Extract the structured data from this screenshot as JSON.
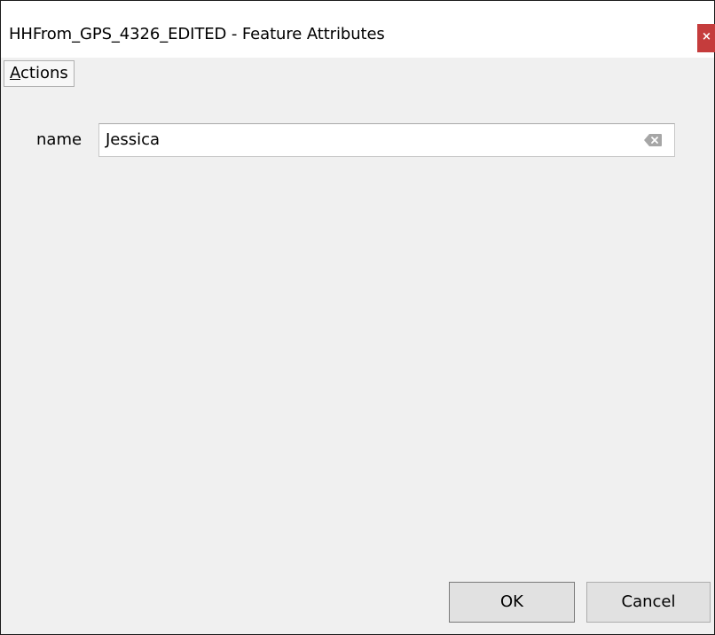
{
  "window": {
    "title": "HHFrom_GPS_4326_EDITED - Feature Attributes",
    "close_icon": "close-icon",
    "close_glyph": "×"
  },
  "menu": {
    "items": [
      {
        "label_prefix": "A",
        "label_rest": "ctions"
      }
    ]
  },
  "form": {
    "fields": [
      {
        "label": "name",
        "value": "Jessica",
        "clear_icon": "clear-icon"
      }
    ]
  },
  "buttons": {
    "ok_label": "OK",
    "cancel_label": "Cancel"
  },
  "colors": {
    "close_bg": "#c53c3c",
    "window_bg": "#f0f0f0",
    "button_bg": "#e1e1e1"
  }
}
